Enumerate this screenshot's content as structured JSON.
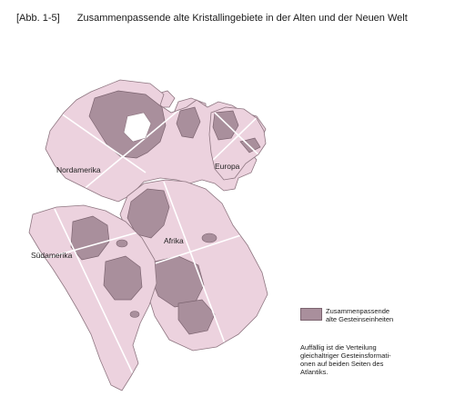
{
  "figure": {
    "number": "[Abb. 1-5]",
    "title": "Zusammenpassende alte Kristallingebiete in der Alten und der Neuen Welt"
  },
  "map": {
    "labels": {
      "nordamerika": "Nordamerika",
      "europa": "Europa",
      "afrika": "Afrika",
      "suedamerika": "Südamerika"
    },
    "colors": {
      "continent": "#ecd2de",
      "continent_outline": "#8e7681",
      "shield": "#a98f9c",
      "shield_outline": "#7c6470",
      "grid_line": "#ffffff"
    }
  },
  "legend": {
    "label_line1": "Zusammenpassende",
    "label_line2": "alte Gesteinseinheiten"
  },
  "note": {
    "line1": "Auffällig ist die Verteilung",
    "line2": "gleichaltriger Gesteinsformati-",
    "line3": "onen auf beiden Seiten des",
    "line4": "Atlantiks."
  }
}
